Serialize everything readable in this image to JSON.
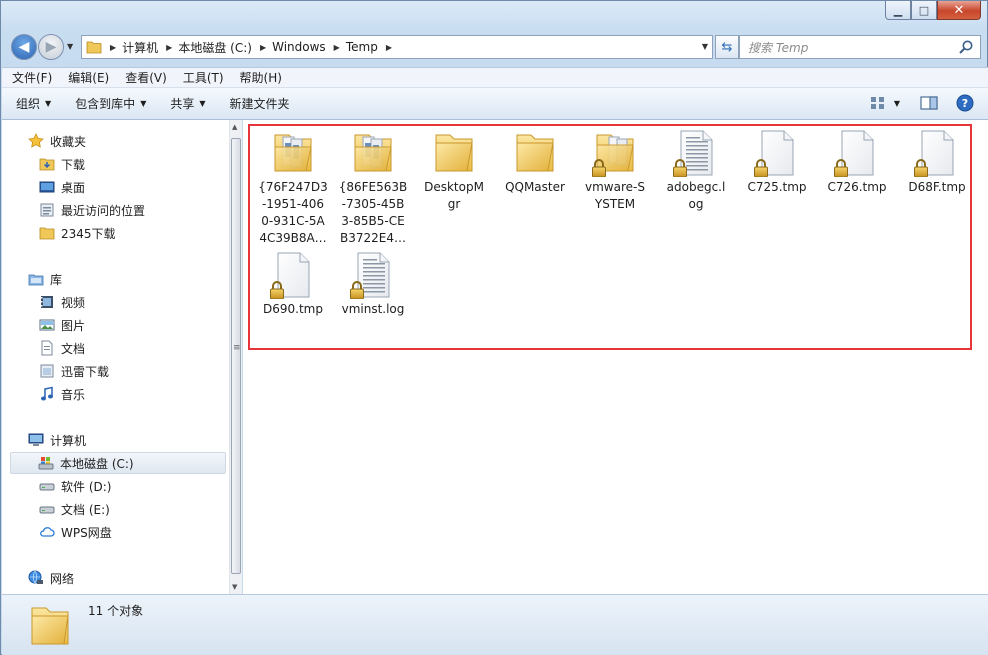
{
  "window": {
    "caption_buttons": {
      "minimize": "▁",
      "maximize": "□",
      "close": "✕"
    }
  },
  "address_bar": {
    "crumbs": [
      "计算机",
      "本地磁盘 (C:)",
      "Windows",
      "Temp"
    ]
  },
  "search": {
    "placeholder": "搜索 Temp"
  },
  "menu": [
    "文件(F)",
    "编辑(E)",
    "查看(V)",
    "工具(T)",
    "帮助(H)"
  ],
  "commands": {
    "organize": "组织",
    "include_library": "包含到库中",
    "share": "共享",
    "new_folder": "新建文件夹"
  },
  "nav_pane": {
    "favorites": {
      "label": "收藏夹",
      "items": [
        "下载",
        "桌面",
        "最近访问的位置",
        "2345下载"
      ]
    },
    "libraries": {
      "label": "库",
      "items": [
        "视频",
        "图片",
        "文档",
        "迅雷下载",
        "音乐"
      ]
    },
    "computer": {
      "label": "计算机",
      "items": [
        "本地磁盘 (C:)",
        "软件 (D:)",
        "文档 (E:)",
        "WPS网盘"
      ],
      "selected": "本地磁盘 (C:)"
    },
    "network": {
      "label": "网络"
    }
  },
  "files": [
    {
      "name": "{76F247D3-1951-4060-931C-5A4C39B8A…",
      "lines": [
        "{76F247D3",
        "-1951-406",
        "0-931C-5A",
        "4C39B8A…"
      ],
      "type": "folder-docs"
    },
    {
      "name": "{86FE563B-7305-45B3-85B5-CEB3722E4…",
      "lines": [
        "{86FE563B",
        "-7305-45B",
        "3-85B5-CE",
        "B3722E4…"
      ],
      "type": "folder-docs"
    },
    {
      "name": "DesktopMgr",
      "lines": [
        "DesktopM",
        "gr"
      ],
      "type": "folder"
    },
    {
      "name": "QQMaster",
      "lines": [
        "QQMaster"
      ],
      "type": "folder"
    },
    {
      "name": "vmware-SYSTEM",
      "lines": [
        "vmware-S",
        "YSTEM"
      ],
      "type": "folder-locked"
    },
    {
      "name": "adobegc.log",
      "lines": [
        "adobegc.l",
        "og"
      ],
      "type": "text-locked"
    },
    {
      "name": "C725.tmp",
      "lines": [
        "C725.tmp"
      ],
      "type": "file-locked"
    },
    {
      "name": "C726.tmp",
      "lines": [
        "C726.tmp"
      ],
      "type": "file-locked"
    },
    {
      "name": "D68F.tmp",
      "lines": [
        "D68F.tmp"
      ],
      "type": "file-locked"
    },
    {
      "name": "D690.tmp",
      "lines": [
        "D690.tmp"
      ],
      "type": "file-locked"
    },
    {
      "name": "vminst.log",
      "lines": [
        "vminst.log"
      ],
      "type": "text-locked"
    }
  ],
  "status": {
    "item_count": "11 个对象"
  },
  "colors": {
    "highlight_border": "#e8343b",
    "folder": "#f2cf61",
    "accent": "#2c64b2"
  }
}
